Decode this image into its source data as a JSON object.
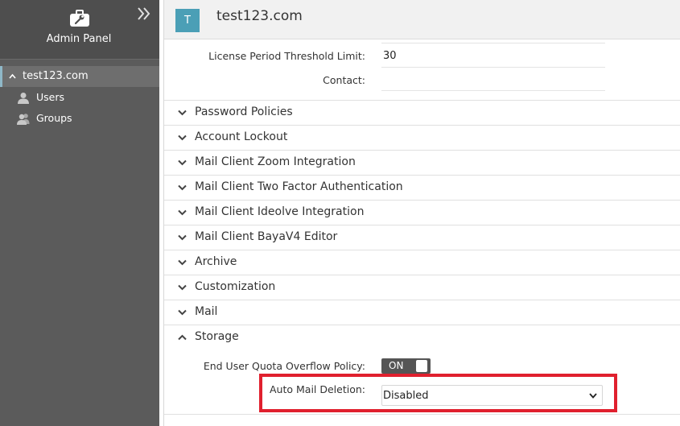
{
  "sidebar": {
    "title": "Admin Panel",
    "icons": {
      "header": "wrench-briefcase-icon",
      "collapse": "double-chevron-right-icon"
    },
    "tree": {
      "domain": "test123.com",
      "items": [
        {
          "label": "Users",
          "icon": "user-icon"
        },
        {
          "label": "Groups",
          "icon": "users-icon"
        }
      ]
    }
  },
  "header": {
    "avatar_letter": "T",
    "title": "test123.com",
    "avatar_color": "#4b9fb6"
  },
  "license": {
    "threshold_label": "License Period Threshold Limit:",
    "threshold_value": "30",
    "contact_label": "Contact:",
    "contact_value": ""
  },
  "sections": [
    "Password Policies",
    "Account Lockout",
    "Mail Client Zoom Integration",
    "Mail Client Two Factor Authentication",
    "Mail Client Ideolve Integration",
    "Mail Client BayaV4 Editor",
    "Archive",
    "Customization",
    "Mail",
    "Storage"
  ],
  "storage": {
    "expanded": true,
    "quota_label": "End User Quota Overflow Policy:",
    "quota_toggle": "ON",
    "deletion_label": "Auto Mail Deletion:",
    "deletion_value": "Disabled"
  },
  "colors": {
    "highlight": "#e0202e",
    "sidebar": "#5b5b5b",
    "toggle": "#555555"
  }
}
